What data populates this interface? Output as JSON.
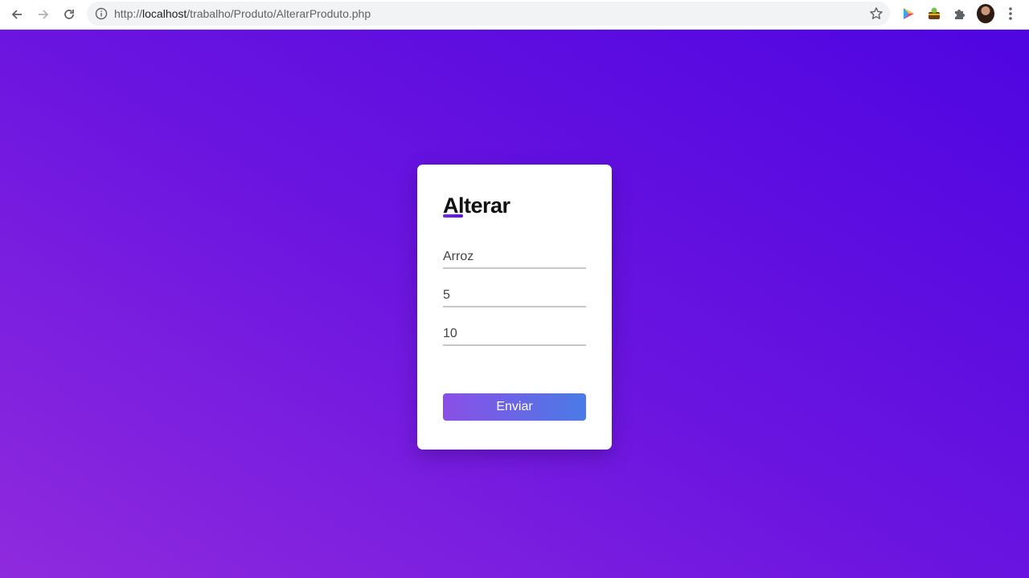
{
  "browser": {
    "url_scheme": "http://",
    "url_host": "localhost",
    "url_path": "/trabalho/Produto/AlterarProduto.php"
  },
  "form": {
    "title": "Alterar",
    "fields": [
      {
        "value": "Arroz"
      },
      {
        "value": "5"
      },
      {
        "value": "10"
      }
    ],
    "submit_label": "Enviar"
  },
  "colors": {
    "background_gradient_start": "#8f2ade",
    "background_gradient_end": "#4f05e1",
    "button_gradient_start": "#8a4fe6",
    "button_gradient_end": "#4a7be6",
    "title_accent": "#6a14e0"
  },
  "icons": {
    "back": "arrow-left-icon",
    "forward": "arrow-right-icon",
    "reload": "reload-icon",
    "site_info": "info-icon",
    "bookmark": "star-icon",
    "extension_1": "play-icon",
    "extension_2": "extension-app-icon",
    "extensions": "puzzle-icon",
    "profile": "avatar",
    "menu": "more-vert-icon"
  }
}
